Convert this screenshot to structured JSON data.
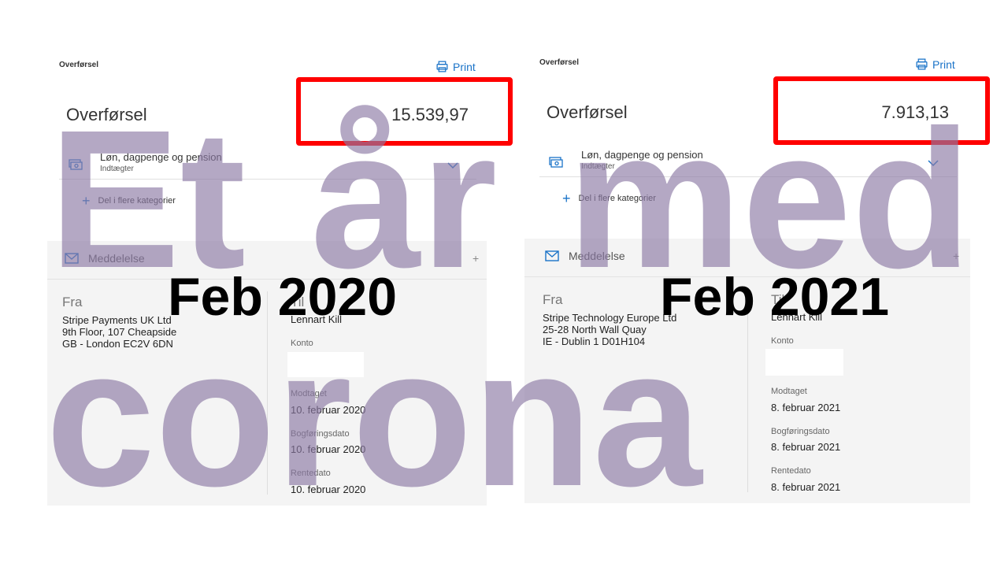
{
  "panels": [
    {
      "header_label": "Overførsel",
      "print_label": "Print",
      "title": "Overførsel",
      "amount": "15.539,97",
      "category": {
        "name": "Løn, dagpenge og pension",
        "sub": "Indtægter",
        "icon": "money-icon"
      },
      "split_label": "Del i flere kategorier",
      "message_label": "Meddelelse",
      "fra_label": "Fra",
      "fra_lines": [
        "Stripe Payments UK Ltd",
        "9th Floor, 107 Cheapside",
        "GB - London EC2V 6DN"
      ],
      "til_label": "Til",
      "til_name": "Lennart Kill",
      "konto_label": "Konto",
      "modtaget_label": "Modtaget",
      "modtaget": "10. februar 2020",
      "bogforing_label": "Bogføringsdato",
      "bogforing": "10. februar 2020",
      "rente_label": "Rentedato",
      "rente": "10. februar 2020"
    },
    {
      "header_label": "Overførsel",
      "print_label": "Print",
      "title": "Overførsel",
      "amount": "7.913,13",
      "category": {
        "name": "Løn, dagpenge og pension",
        "sub": "Indtægter",
        "icon": "money-icon"
      },
      "split_label": "Del i flere kategorier",
      "message_label": "Meddelelse",
      "fra_label": "Fra",
      "fra_lines": [
        "Stripe Technology Europe Ltd",
        "25-28 North Wall Quay",
        "IE - Dublin 1 D01H104"
      ],
      "til_label": "Til",
      "til_name": "Lennart Kill",
      "konto_label": "Konto",
      "modtaget_label": "Modtaget",
      "modtaget": "8. februar 2021",
      "bogforing_label": "Bogføringsdato",
      "bogforing": "8. februar 2021",
      "rente_label": "Rentedato",
      "rente": "8. februar 2021"
    }
  ],
  "overlay": {
    "words": [
      "Et",
      "år",
      "med",
      "corona"
    ],
    "date_left": "Feb 2020",
    "date_right": "Feb 2021",
    "highlight_color": "#ff0000",
    "text_color": "#8c7aa5"
  },
  "colors": {
    "accent": "#1a73c8",
    "panel_grey": "#f4f4f4"
  }
}
